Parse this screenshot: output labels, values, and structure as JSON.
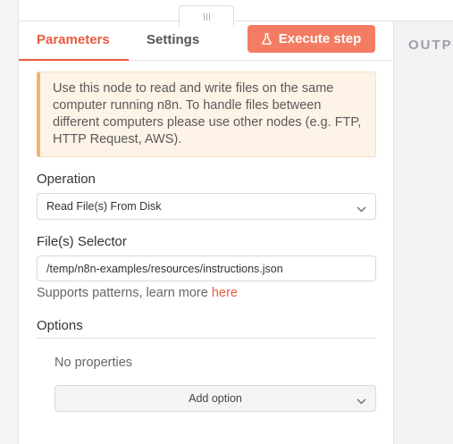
{
  "tabs": {
    "parameters": "Parameters",
    "settings": "Settings"
  },
  "execute_button": {
    "label": "Execute step",
    "icon": "flask-icon"
  },
  "output_pane": {
    "label": "OUTPUT"
  },
  "notice": {
    "text": "Use this node to read and write files on the same computer running n8n. To handle files between different computers please use other nodes (e.g. FTP, HTTP Request, AWS)."
  },
  "operation": {
    "label": "Operation",
    "value": "Read File(s) From Disk"
  },
  "file_selector": {
    "label": "File(s) Selector",
    "value": "/temp/n8n-examples/resources/instructions.json",
    "hint": "Supports patterns, learn more ",
    "hint_link": "here"
  },
  "options": {
    "title": "Options",
    "empty_text": "No properties",
    "add_label": "Add option"
  },
  "colors": {
    "accent": "#ea5b3f",
    "button": "#f47c62",
    "notice_bg": "#fdf3e7",
    "notice_border": "#f2b46a"
  }
}
